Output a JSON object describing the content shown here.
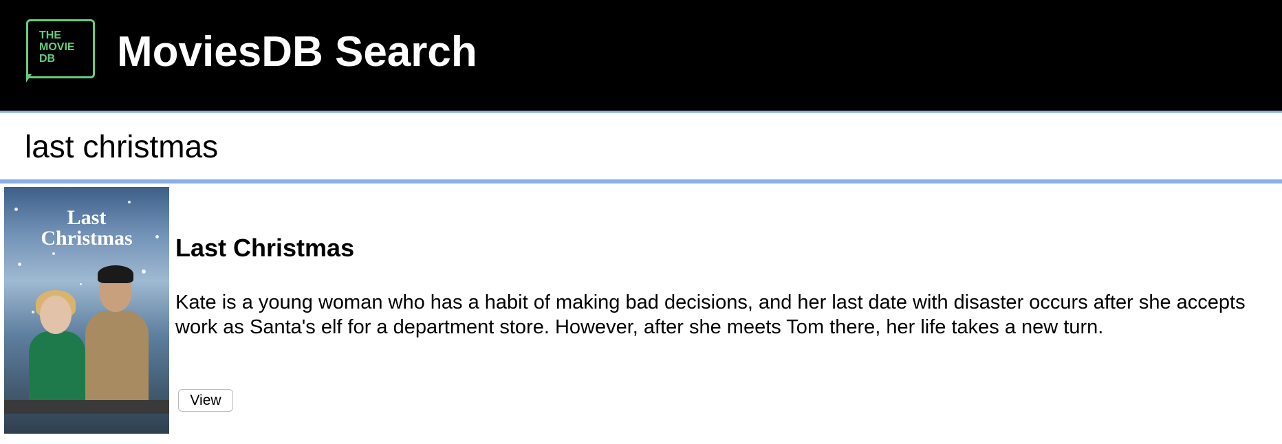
{
  "header": {
    "logo_text": "THE\nMOVIE\nDB",
    "app_title": "MoviesDB Search",
    "background_color": "#000000",
    "logo_color": "#66cc80"
  },
  "search": {
    "value": "last christmas",
    "border_color": "#8aaee8"
  },
  "results": [
    {
      "poster_title": "Last\nChristmas",
      "title": "Last Christmas",
      "overview": "Kate is a young woman who has a habit of making bad decisions, and her last date with disaster occurs after she accepts work as Santa's elf for a department store. However, after she meets Tom there, her life takes a new turn.",
      "view_label": "View"
    }
  ]
}
